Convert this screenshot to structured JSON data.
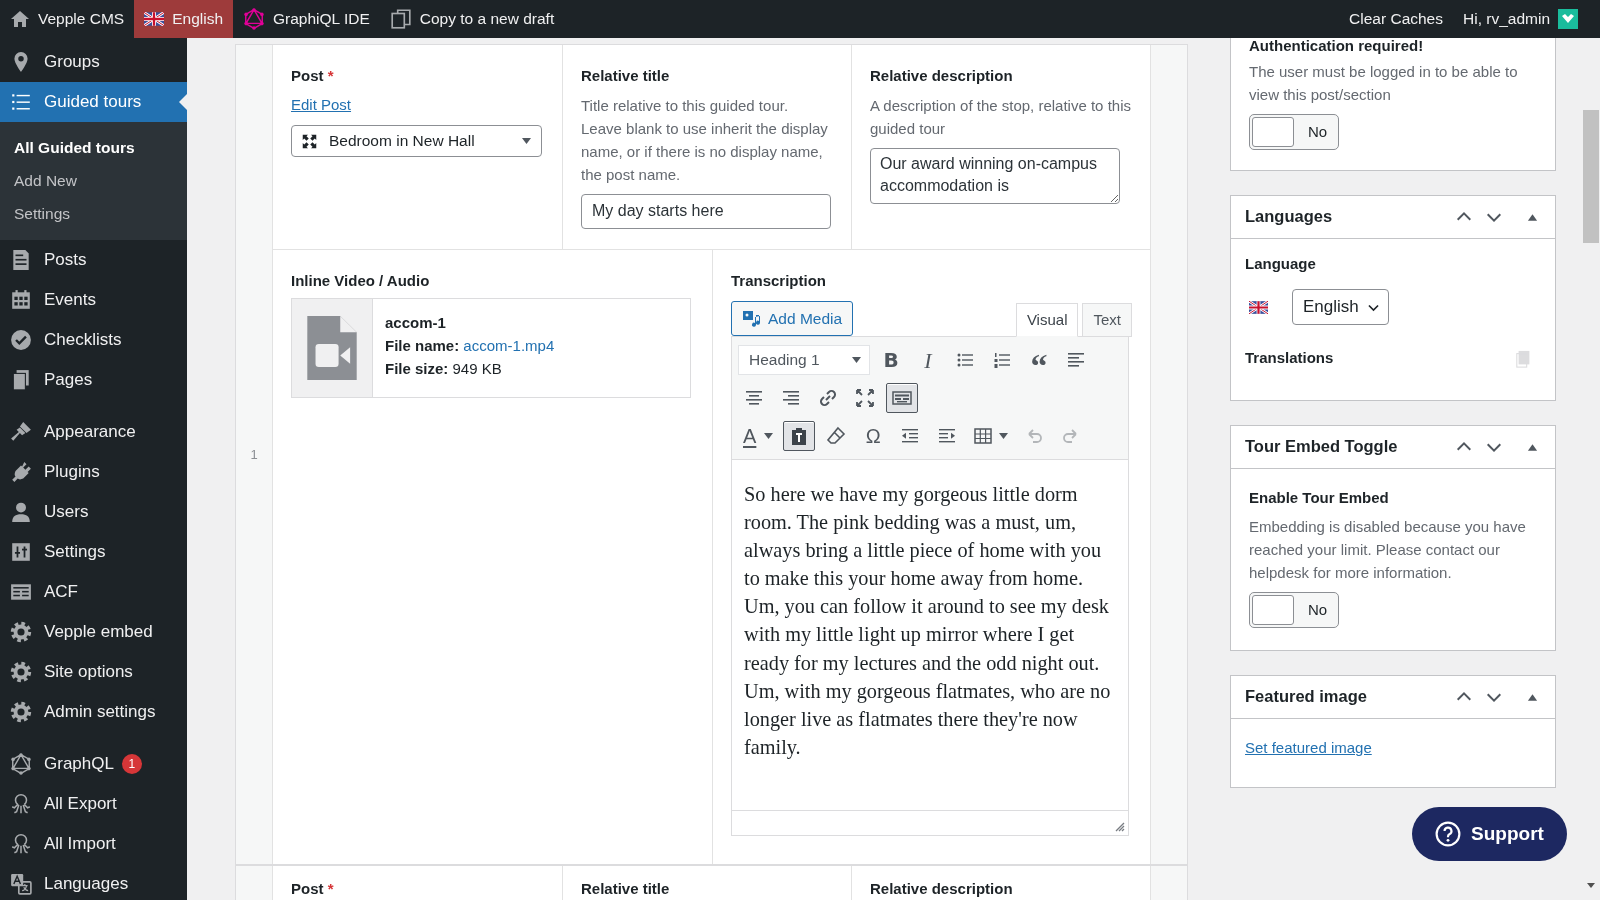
{
  "topbar": {
    "left": [
      {
        "label": "Vepple CMS",
        "selected": false
      },
      {
        "label": "English",
        "selected": true
      },
      {
        "label": "GraphiQL IDE",
        "selected": false
      },
      {
        "label": "Copy to a new draft",
        "selected": false
      }
    ],
    "right": [
      "Clear Caches",
      "Hi, rv_admin"
    ]
  },
  "sidebar": {
    "groups": [
      [
        {
          "label": "Groups",
          "selected": false
        },
        {
          "label": "Guided tours",
          "selected": true,
          "children": [
            {
              "label": "All Guided tours",
              "selected": true
            },
            {
              "label": "Add New",
              "selected": false
            },
            {
              "label": "Settings",
              "selected": false
            }
          ]
        },
        {
          "label": "Posts",
          "selected": false
        },
        {
          "label": "Events",
          "selected": false
        },
        {
          "label": "Checklists",
          "selected": false
        },
        {
          "label": "Pages",
          "selected": false
        }
      ],
      [
        {
          "label": "Appearance",
          "selected": false
        },
        {
          "label": "Plugins",
          "selected": false
        },
        {
          "label": "Users",
          "selected": false
        },
        {
          "label": "Settings",
          "selected": false
        },
        {
          "label": "ACF",
          "selected": false
        },
        {
          "label": "Vepple embed",
          "selected": false
        },
        {
          "label": "Site options",
          "selected": false
        },
        {
          "label": "Admin settings",
          "selected": false
        }
      ],
      [
        {
          "label": "GraphQL",
          "selected": false,
          "badge": "1"
        },
        {
          "label": "All Export",
          "selected": false
        },
        {
          "label": "All Import",
          "selected": false
        },
        {
          "label": "Languages",
          "selected": false
        }
      ]
    ]
  },
  "rows": [
    {
      "number": "1",
      "post": {
        "label": "Post",
        "required_mark": "*",
        "link": "Edit Post",
        "value": "Bedroom in New Hall"
      },
      "relative_title": {
        "label": "Relative title",
        "description": "Title relative to this guided tour. Leave blank to use inherit the display name, or if there is no display name, the post name.",
        "value": "My day starts here"
      },
      "relative_description": {
        "label": "Relative description",
        "description": "A description of the stop, relative to this guided tour",
        "value": "Our award winning on-campus accommodation is"
      },
      "media": {
        "label": "Inline Video / Audio",
        "title": "accom-1",
        "file_name_label": "File name:",
        "file_name": "accom-1.mp4",
        "file_size_label": "File size:",
        "file_size": "949 KB"
      },
      "transcription": {
        "label": "Transcription",
        "add_media": "Add Media",
        "tabs": [
          {
            "label": "Visual",
            "selected": true
          },
          {
            "label": "Text",
            "selected": false
          }
        ],
        "toolbar": [
          [
            {
              "kind": "format",
              "value": "Heading 1"
            },
            {
              "kind": "bold",
              "glyph": "B",
              "active": false,
              "disabled": false
            },
            {
              "kind": "italic",
              "glyph": "I",
              "active": false,
              "disabled": false
            },
            {
              "kind": "bullets",
              "active": false,
              "disabled": false
            },
            {
              "kind": "numbers",
              "active": false,
              "disabled": false
            },
            {
              "kind": "quote",
              "glyph": "“",
              "active": false,
              "disabled": false
            },
            {
              "kind": "align-left",
              "active": false,
              "disabled": false
            }
          ],
          [
            {
              "kind": "align-center",
              "active": false,
              "disabled": false
            },
            {
              "kind": "align-right",
              "active": false,
              "disabled": false
            },
            {
              "kind": "link",
              "active": false,
              "disabled": false
            },
            {
              "kind": "fullscreen",
              "active": false,
              "disabled": false
            },
            {
              "kind": "keyboard",
              "active": true,
              "disabled": false
            }
          ],
          [
            {
              "kind": "text-color",
              "glyph": "A",
              "active": false,
              "disabled": false
            },
            {
              "kind": "clipboard",
              "active": true,
              "disabled": false
            },
            {
              "kind": "eraser",
              "active": false,
              "disabled": false
            },
            {
              "kind": "omega",
              "glyph": "Ω",
              "active": false,
              "disabled": false
            },
            {
              "kind": "outdent",
              "active": false,
              "disabled": false
            },
            {
              "kind": "indent",
              "active": false,
              "disabled": false
            },
            {
              "kind": "table",
              "active": false,
              "disabled": false
            },
            {
              "kind": "undo",
              "active": false,
              "disabled": true
            },
            {
              "kind": "redo",
              "active": false,
              "disabled": true
            }
          ]
        ],
        "content": "So here we have my gorgeous little dorm room. The pink bedding was a must, um, always bring a little piece of home with you to make this your home away from home. Um, you can follow it around to see my desk with my little light up mirror where I get ready for my lectures and the odd night out. Um, with my gorgeous flatmates, who are no longer live as flatmates there they're now family."
      }
    },
    {
      "post": {
        "label": "Post",
        "required_mark": "*"
      },
      "relative_title": {
        "label": "Relative title"
      },
      "relative_description": {
        "label": "Relative description"
      }
    }
  ],
  "side": {
    "auth": {
      "title": "Authentication required!",
      "description": "The user must be logged in to be able to view this post/section",
      "toggle": {
        "on": false,
        "label": "No"
      }
    },
    "languages": {
      "title": "Languages",
      "language_label": "Language",
      "language": "English",
      "translations_label": "Translations"
    },
    "embed": {
      "title": "Tour Embed Toggle",
      "field_label": "Enable Tour Embed",
      "description": "Embedding is disabled because you have reached your limit. Please contact our helpdesk for more information.",
      "toggle": {
        "on": false,
        "label": "No"
      }
    },
    "featured": {
      "title": "Featured image",
      "link": "Set featured image"
    }
  },
  "support": "Support"
}
